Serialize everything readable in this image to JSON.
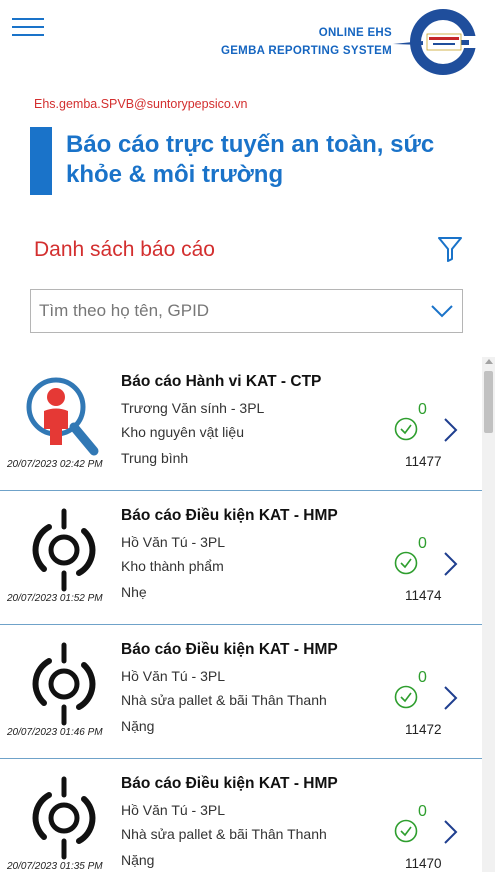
{
  "header": {
    "menu_icon": "hamburger-menu-icon",
    "brand_line1": "ONLINE EHS",
    "brand_line2": "GEMBA REPORTING SYSTEM",
    "logo_icon": "ehs-gemba-logo-icon"
  },
  "user": {
    "email": "Ehs.gemba.SPVB@suntorypepsico.vn"
  },
  "page": {
    "title": "Báo cáo trực tuyến an toàn, sức khỏe & môi trường"
  },
  "list_section": {
    "title": "Danh sách báo cáo",
    "filter_icon": "filter-funnel-icon"
  },
  "search": {
    "placeholder": "Tìm theo họ tên, GPID",
    "value": ""
  },
  "colors": {
    "accent": "#1a73c9",
    "alert": "#d32f2f",
    "success": "#2e9e2e",
    "divider": "#6fa2c9"
  },
  "reports": [
    {
      "icon": "behavior-search-person-icon",
      "title": "Báo cáo Hành vi KAT - CTP",
      "person": "Trương Văn sính - 3PL",
      "location": "Kho nguyên vật liệu",
      "severity": "Trung bình",
      "count": "0",
      "id": "11477",
      "date": "20/07/2023 02:42 PM"
    },
    {
      "icon": "condition-hook-icon",
      "title": "Báo cáo Điều kiện KAT - HMP",
      "person": "Hồ Văn Tú - 3PL",
      "location": "Kho thành phẩm",
      "severity": "Nhẹ",
      "count": "0",
      "id": "11474",
      "date": "20/07/2023 01:52 PM"
    },
    {
      "icon": "condition-hook-icon",
      "title": "Báo cáo Điều kiện KAT - HMP",
      "person": "Hồ Văn Tú - 3PL",
      "location": "Nhà sửa pallet & bãi Thân Thanh",
      "severity": "Nặng",
      "count": "0",
      "id": "11472",
      "date": "20/07/2023 01:46 PM"
    },
    {
      "icon": "condition-hook-icon",
      "title": "Báo cáo Điều kiện KAT - HMP",
      "person": "Hồ Văn Tú - 3PL",
      "location": "Nhà sửa pallet & bãi Thân Thanh",
      "severity": "Nặng",
      "count": "0",
      "id": "11470",
      "date": "20/07/2023 01:35 PM"
    }
  ]
}
